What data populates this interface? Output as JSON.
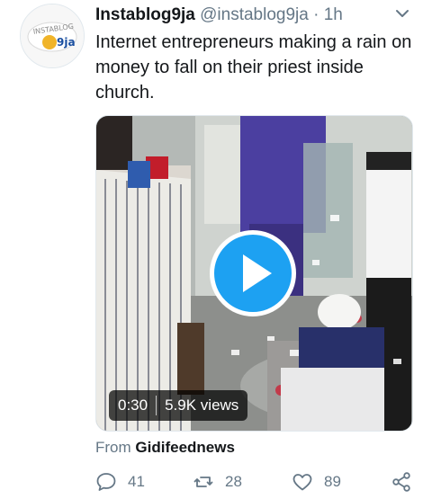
{
  "tweet": {
    "display_name": "Instablog9ja",
    "handle": "@instablog9ja",
    "separator": "·",
    "time": "1h",
    "text": "Internet entrepreneurs making a rain on money to fall on their priest inside church.",
    "avatar_logo_text": "INSTABLOG 9ja",
    "video": {
      "duration": "0:30",
      "views": "5.9K views"
    },
    "source_prefix": "From",
    "source_name": "Gidifeednews",
    "actions": {
      "replies": "41",
      "retweets": "28",
      "likes": "89"
    }
  },
  "icons": [
    "caret-down-icon",
    "play-icon",
    "reply-icon",
    "retweet-icon",
    "like-icon",
    "share-icon"
  ],
  "colors": {
    "accent": "#1da1f2",
    "muted": "#657786",
    "text": "#14171a"
  }
}
